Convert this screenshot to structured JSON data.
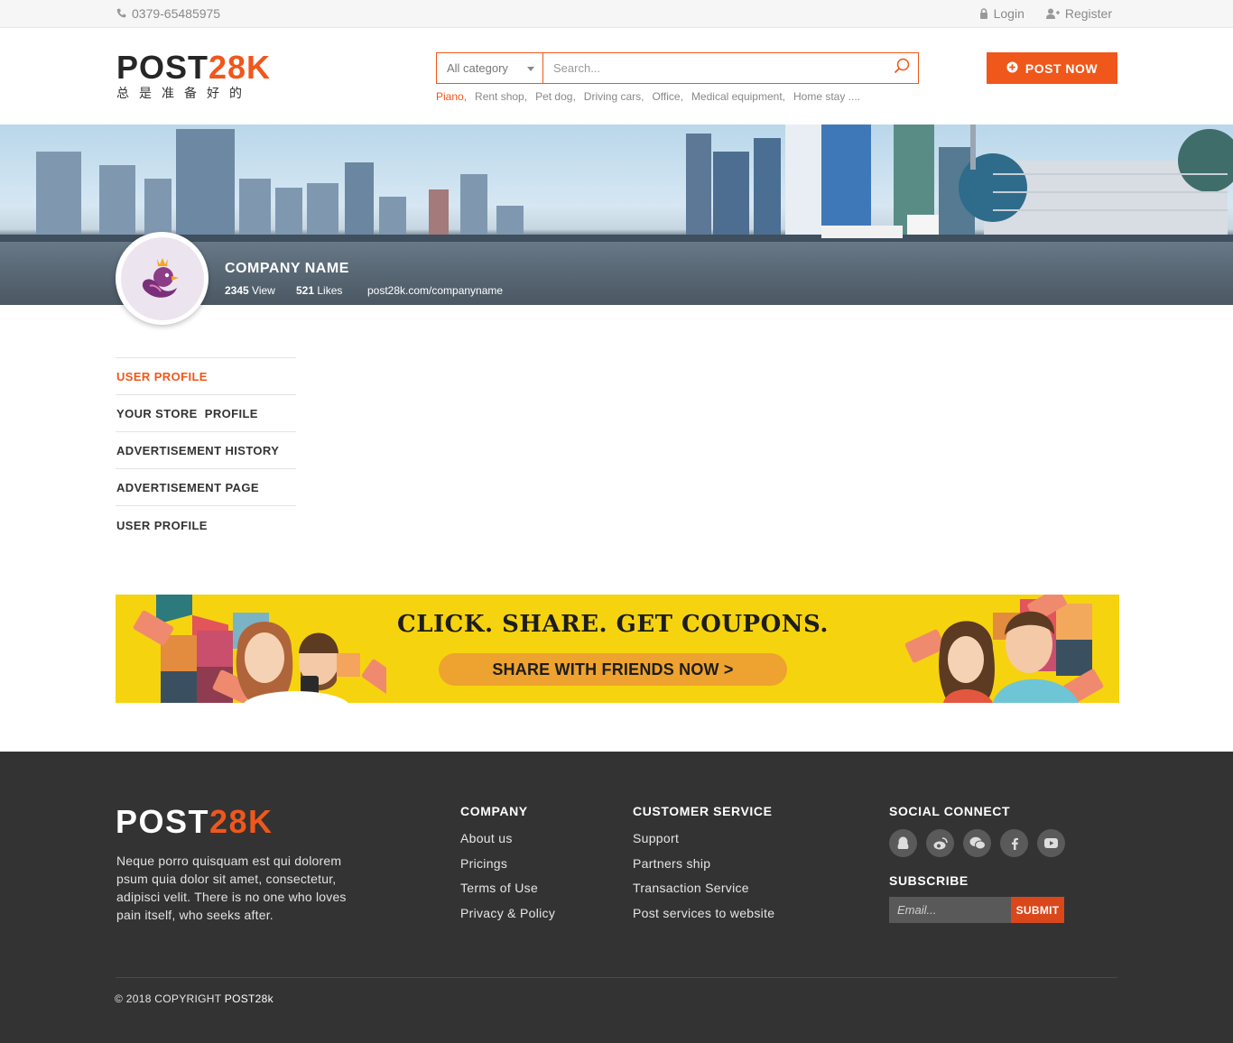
{
  "topbar": {
    "phone": "0379-65485975",
    "login": "Login",
    "register": "Register"
  },
  "header": {
    "logo_main": "POST",
    "logo_accent": "28K",
    "logo_tagline": "总是准备好的",
    "category_select": "All category",
    "search_placeholder": "Search...",
    "tags": [
      "Piano,",
      "Rent shop,",
      "Pet dog,",
      "Driving cars,",
      "Office,",
      "Medical equipment,",
      "Home stay ...."
    ],
    "post_button": "POST NOW"
  },
  "profile": {
    "company_name": "COMPANY NAME",
    "views_count": "2345",
    "views_label": "View",
    "likes_count": "521",
    "likes_label": "Likes",
    "url": "post28k.com/companyname"
  },
  "sidemenu": {
    "items": [
      "USER PROFILE",
      "YOUR STORE  PROFILE",
      "ADVERTISEMENT HISTORY",
      "ADVERTISEMENT PAGE",
      "USER PROFILE"
    ]
  },
  "promo": {
    "headline": "CLICK. SHARE. GET COUPONS.",
    "cta": "SHARE WITH FRIENDS NOW  >"
  },
  "footer": {
    "logo_main": "POST",
    "logo_accent": "28K",
    "description": "Neque porro quisquam est qui dolorem psum quia dolor sit amet, consectetur, adipisci velit. There is no one who loves pain itself, who seeks after.",
    "company": {
      "title": "COMPANY",
      "links": [
        "About us",
        "Pricings",
        "Terms of Use",
        "Privacy & Policy"
      ]
    },
    "customer_service": {
      "title": "CUSTOMER SERVICE",
      "links": [
        "Support",
        "Partners ship",
        "Transaction Service",
        "Post services to website"
      ]
    },
    "social": {
      "title": "SOCIAL CONNECT",
      "icons": [
        "qq-icon",
        "weibo-icon",
        "wechat-icon",
        "facebook-icon",
        "youtube-icon"
      ]
    },
    "subscribe": {
      "title": "SUBSCRIBE",
      "email_placeholder": "Email...",
      "submit": "SUBMIT"
    },
    "copyright_prefix": "© 2018 COPYRIGHT",
    "copyright_brand": "POST28k"
  },
  "colors": {
    "accent": "#f0571b",
    "footer_bg": "#333333",
    "promo_bg": "#f6d30f"
  }
}
